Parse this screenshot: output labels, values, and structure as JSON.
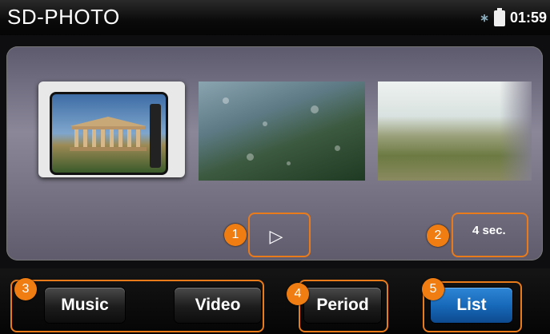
{
  "titlebar": {
    "title": "SD-PHOTO",
    "time": "01:59"
  },
  "slideshow": {
    "play_icon": "▷",
    "interval": "4 sec."
  },
  "buttons": {
    "music": "Music",
    "video": "Video",
    "period": "Period",
    "list": "List"
  },
  "callouts": {
    "c1": "1",
    "c2": "2",
    "c3": "3",
    "c4": "4",
    "c5": "5"
  },
  "colors": {
    "accent": "#ef7d12",
    "list_button": "#1f74c8"
  }
}
